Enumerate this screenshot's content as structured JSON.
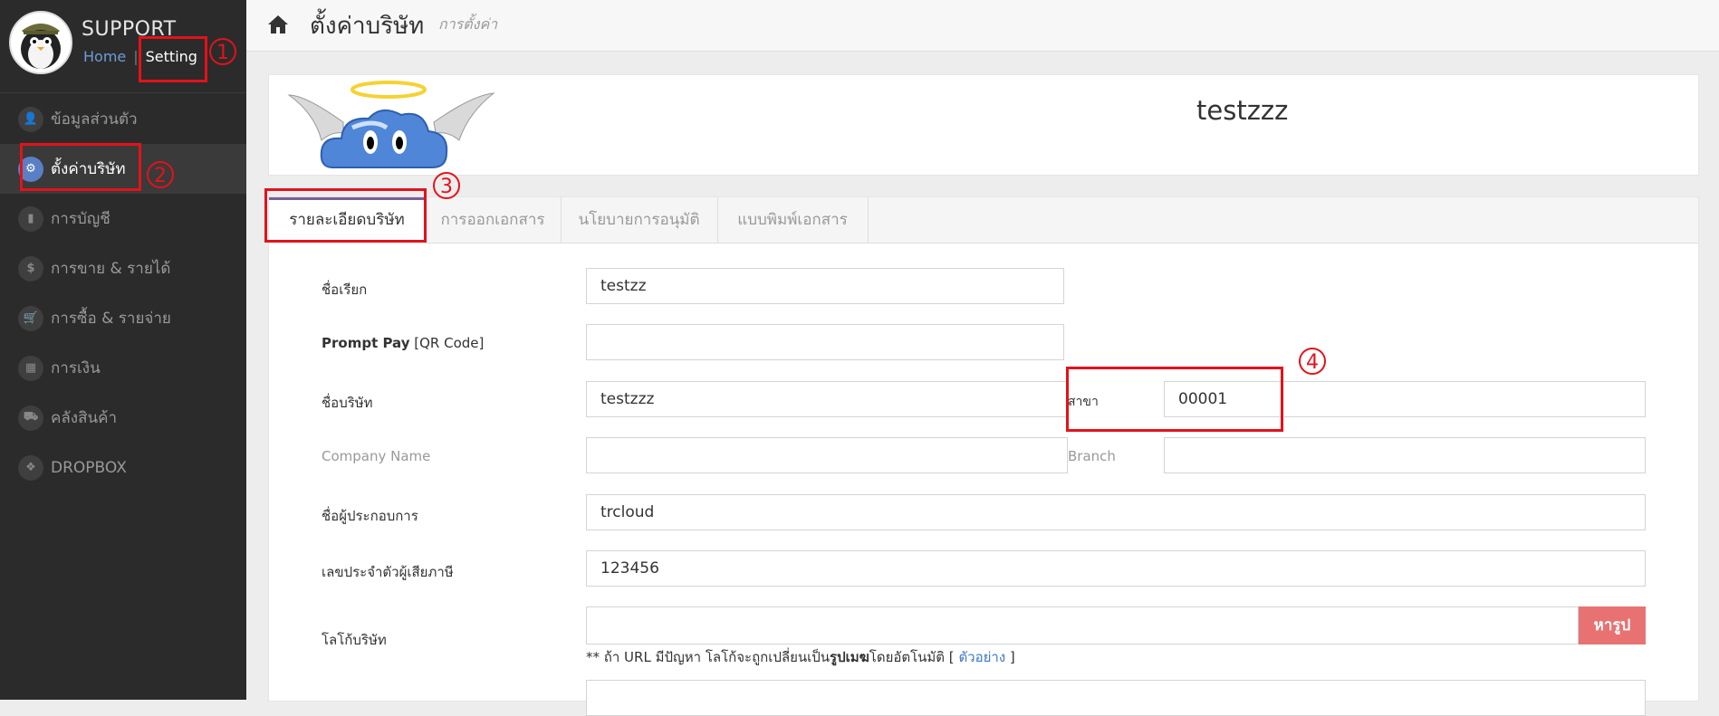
{
  "sidebar": {
    "brand": "SUPPORT",
    "home_link": "Home",
    "separator": "|",
    "setting_link": "Setting",
    "items": [
      {
        "label": "ข้อมูลส่วนตัว",
        "icon": "user-icon",
        "glyph": "👤"
      },
      {
        "label": "ตั้งค่าบริษัท",
        "icon": "gear-icon",
        "glyph": "⚙"
      },
      {
        "label": "การบัญชี",
        "icon": "book-icon",
        "glyph": "▮"
      },
      {
        "label": "การขาย & รายได้",
        "icon": "dollar-icon",
        "glyph": "$"
      },
      {
        "label": "การซื้อ & รายจ่าย",
        "icon": "cart-icon",
        "glyph": "🛒"
      },
      {
        "label": "การเงิน",
        "icon": "calendar-icon",
        "glyph": "▦"
      },
      {
        "label": "คลังสินค้า",
        "icon": "truck-icon",
        "glyph": "⛟"
      },
      {
        "label": "DROPBOX",
        "icon": "dropbox-icon",
        "glyph": "❖"
      }
    ]
  },
  "header": {
    "title": "ตั้งค่าบริษัท",
    "subtitle": "การตั้งค่า"
  },
  "banner": {
    "company_name": "testzzz"
  },
  "tabs": [
    {
      "label": "รายละเอียดบริษัท"
    },
    {
      "label": "การออกเอกสาร"
    },
    {
      "label": "นโยบายการอนุมัติ"
    },
    {
      "label": "แบบพิมพ์เอกสาร"
    }
  ],
  "form": {
    "nickname_label": "ชื่อเรียก",
    "nickname_value": "testzz",
    "promptpay_label_bold": "Prompt Pay",
    "promptpay_label_rest": " [QR Code]",
    "promptpay_value": "",
    "company_label": "ชื่อบริษัท",
    "company_value": "testzzz",
    "branch_th_label": "สาขา",
    "branch_th_value": "00001",
    "company_en_label": "Company Name",
    "company_en_value": "",
    "branch_en_label": "Branch",
    "branch_en_value": "",
    "operator_label": "ชื่อผู้ประกอบการ",
    "operator_value": "trcloud",
    "taxid_label": "เลขประจำตัวผู้เสียภาษี",
    "taxid_value": "123456",
    "logo_label": "โลโก้บริษัท",
    "logo_value": "",
    "remove_button": "หารูป",
    "note_prefix": "** ถ้า URL มีปัญหา โลโก้จะถูกเปลี่ยนเป็น",
    "note_bold": "รูปเมฆ",
    "note_suffix": "โดยอัตโนมัติ  [ ",
    "note_link": "ตัวอย่าง",
    "note_close": " ]"
  },
  "annotations": [
    "1",
    "2",
    "3",
    "4"
  ],
  "colors": {
    "sidebar_bg": "#2b2b2b",
    "active_icon": "#5b7fc4",
    "tab_accent": "#7a5f96",
    "danger": "#e87272",
    "annotation": "#e3121b"
  }
}
